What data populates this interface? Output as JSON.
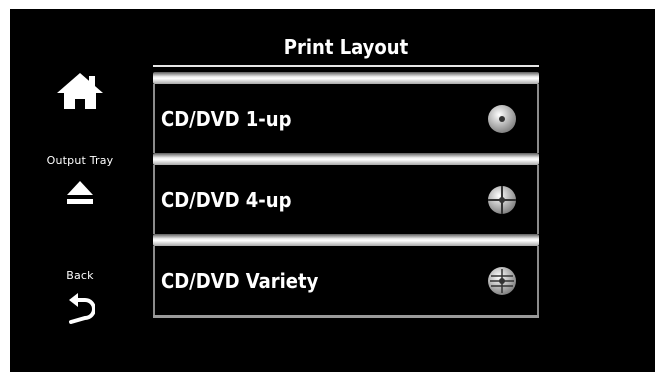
{
  "header": {
    "title": "Print Layout"
  },
  "sidebar": {
    "home": {
      "icon": "home-icon"
    },
    "output_tray": {
      "label": "Output Tray",
      "icon": "eject-icon"
    },
    "back": {
      "label": "Back",
      "icon": "back-arrow-icon"
    }
  },
  "options": [
    {
      "label": "CD/DVD 1-up",
      "icon": "cd-1up-icon"
    },
    {
      "label": "CD/DVD 4-up",
      "icon": "cd-4up-icon"
    },
    {
      "label": "CD/DVD Variety",
      "icon": "cd-variety-icon"
    }
  ]
}
